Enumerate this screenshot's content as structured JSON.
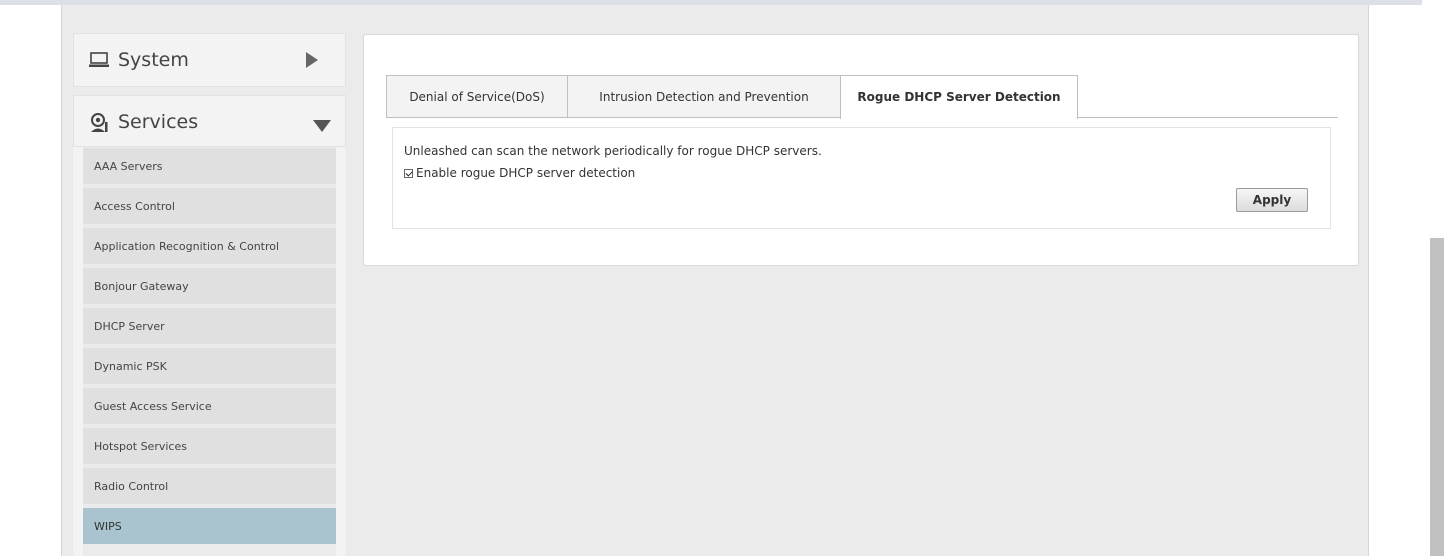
{
  "sidebar": {
    "system": {
      "label": "System",
      "icon": "laptop-icon",
      "arrow": "triangle-right-icon"
    },
    "services": {
      "label": "Services",
      "icon": "services-icon",
      "arrow": "triangle-down-icon"
    },
    "items": [
      {
        "label": "AAA Servers",
        "active": false
      },
      {
        "label": "Access Control",
        "active": false
      },
      {
        "label": "Application Recognition & Control",
        "active": false
      },
      {
        "label": "Bonjour Gateway",
        "active": false
      },
      {
        "label": "DHCP Server",
        "active": false
      },
      {
        "label": "Dynamic PSK",
        "active": false
      },
      {
        "label": "Guest Access Service",
        "active": false
      },
      {
        "label": "Hotspot Services",
        "active": false
      },
      {
        "label": "Radio Control",
        "active": false
      },
      {
        "label": "WIPS",
        "active": true
      }
    ]
  },
  "tabs": [
    {
      "label": "Denial of Service(DoS)",
      "active": false
    },
    {
      "label": "Intrusion Detection and Prevention",
      "active": false
    },
    {
      "label": "Rogue DHCP Server Detection",
      "active": true
    }
  ],
  "content": {
    "description": "Unleashed can scan the network periodically for rogue DHCP servers.",
    "checkbox_label": "Enable rogue DHCP server detection",
    "checkbox_checked": true,
    "apply_label": "Apply"
  },
  "colors": {
    "active_menu": "#a9c4cf",
    "frame_bg": "#ebebeb"
  }
}
